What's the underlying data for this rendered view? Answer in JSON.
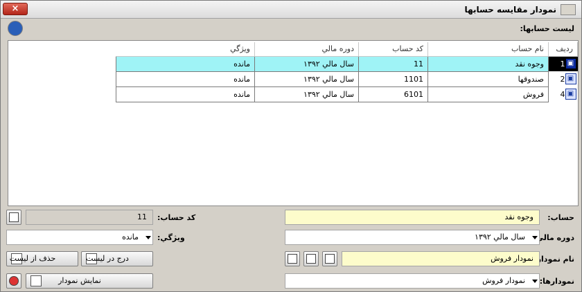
{
  "window": {
    "title": "نمودار مقايسه حسابها",
    "close_label": "×"
  },
  "accounts_list_label": "ليست حسابها:",
  "grid": {
    "columns": [
      "رديف",
      "نام حساب",
      "كد حساب",
      "دوره مالي",
      "ويژگي"
    ],
    "rows": [
      {
        "index": "1",
        "name": "وجوه نقد",
        "code": "11",
        "period": "سال مالي ۱۳۹۲",
        "feature": "مانده",
        "selected": true
      },
      {
        "index": "2",
        "name": "صندوقها",
        "code": "1101",
        "period": "سال مالي ۱۳۹۲",
        "feature": "مانده",
        "selected": false
      },
      {
        "index": "4",
        "name": "فروش",
        "code": "6101",
        "period": "سال مالي ۱۳۹۲",
        "feature": "مانده",
        "selected": false
      }
    ]
  },
  "form": {
    "account_label": "حساب:",
    "account_value": "وجوه نقد",
    "account_code_label": "كد حساب:",
    "account_code_value": "11",
    "period_label": "دوره مالي:",
    "period_value": "سال مالي ۱۳۹۲",
    "feature_label": "ويژگي:",
    "feature_value": "مانده",
    "chart_name_label": "نام نمودار:",
    "chart_name_value": "نمودار فروش",
    "charts_label": "نمودارها:",
    "charts_value": "نمودار فروش"
  },
  "buttons": {
    "delete_from_list": "حذف از ليست",
    "add_to_list": "درج در ليست",
    "show_chart": "نمايش نمودار"
  },
  "colors": {
    "selected_row": "#9ff3f6",
    "yellow_field": "#fdfccb"
  }
}
